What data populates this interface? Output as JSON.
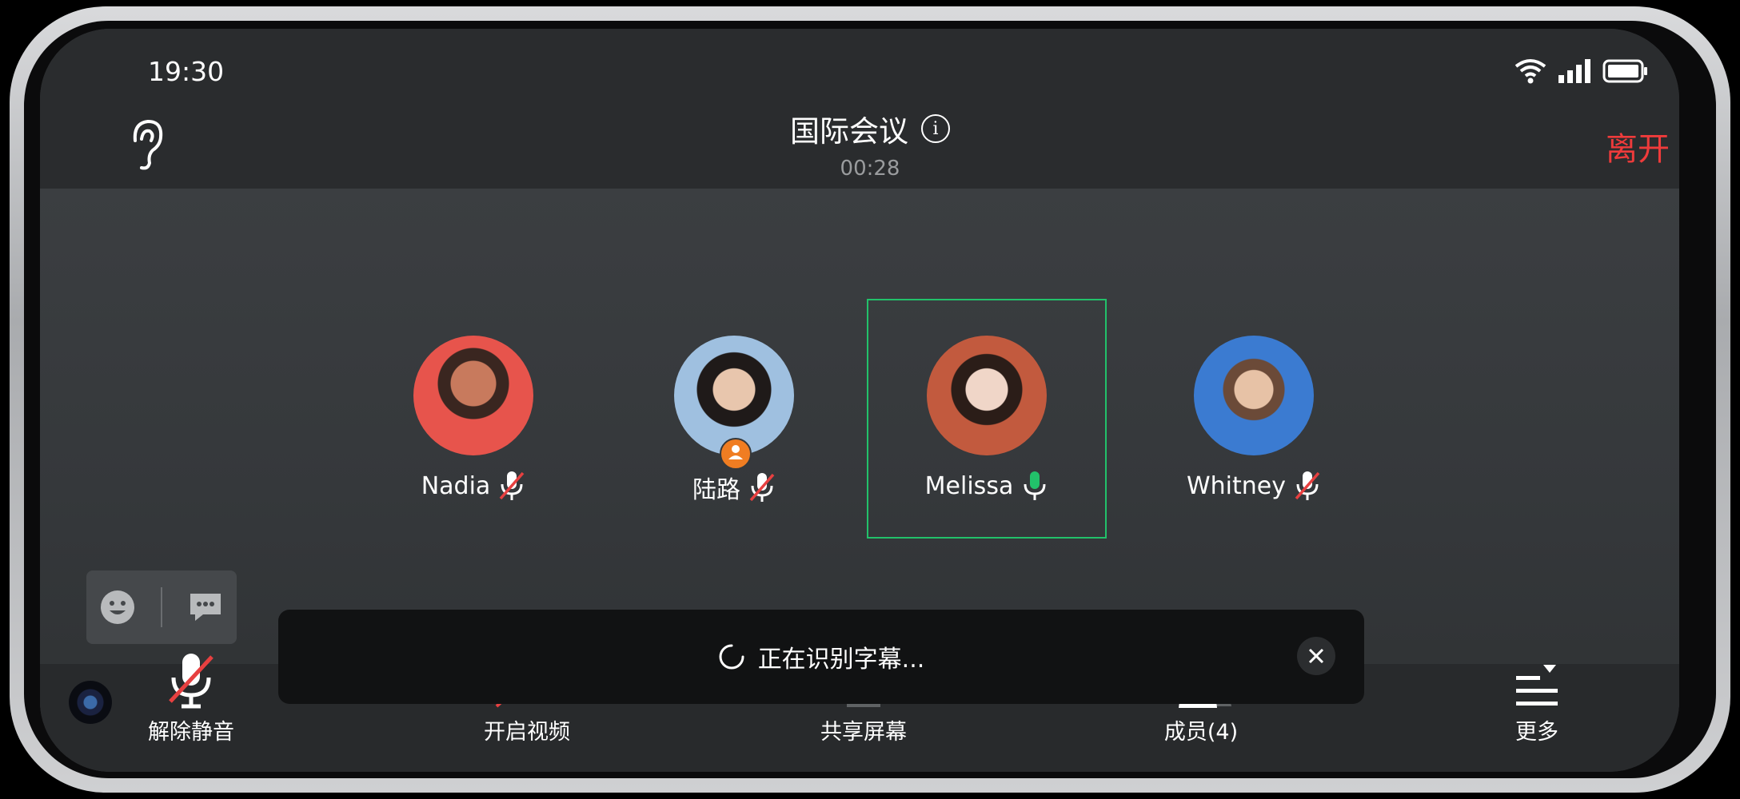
{
  "status_bar": {
    "time": "19:30"
  },
  "header": {
    "title": "国际会议",
    "timer": "00:28",
    "leave_label": "离开"
  },
  "participants": [
    {
      "name": "Nadia",
      "mic": "muted",
      "avatar_color": "#e7544c"
    },
    {
      "name": "陆路",
      "mic": "muted",
      "host": true,
      "avatar_color": "#9fc0e0"
    },
    {
      "name": "Melissa",
      "mic": "active",
      "speaking": true,
      "avatar_color": "#c25a3e"
    },
    {
      "name": "Whitney",
      "mic": "muted",
      "avatar_color": "#3b7bd1"
    }
  ],
  "caption": {
    "text": "正在识别字幕..."
  },
  "toolbar": {
    "unmute": "解除静音",
    "video": "开启视频",
    "share": "共享屏幕",
    "members": "成员(4)",
    "more": "更多"
  },
  "colors": {
    "accent_green": "#22c16a",
    "leave_red": "#ef3b3b",
    "host_orange": "#f07d22"
  }
}
